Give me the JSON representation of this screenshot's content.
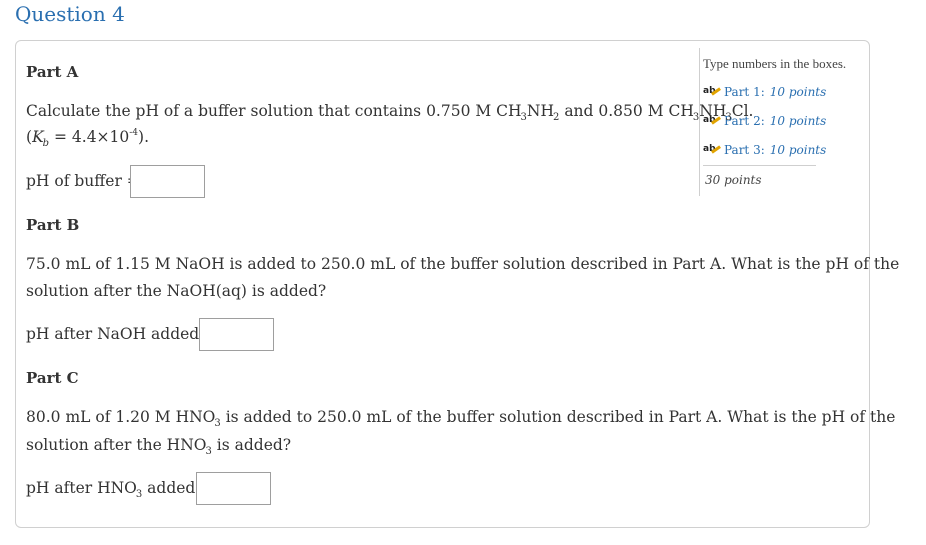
{
  "question": {
    "title": "Question 4"
  },
  "sidebar": {
    "instruction": "Type numbers in the boxes.",
    "parts": [
      {
        "label": "Part 1:",
        "points": "10 points"
      },
      {
        "label": "Part 2:",
        "points": "10 points"
      },
      {
        "label": "Part 3:",
        "points": "10 points"
      }
    ],
    "total": "30 points"
  },
  "part_a": {
    "heading": "Part A",
    "text_1": "Calculate the pH of a buffer solution that contains 0.750 M CH",
    "sub_1": "3",
    "text_2": "NH",
    "sub_2": "2",
    "text_3": " and 0.850 M CH",
    "sub_3": "3",
    "text_4": "NH",
    "sub_4": "3",
    "text_5": "Cl.",
    "kb_open": "(",
    "kb_k": "K",
    "kb_sub": "b",
    "kb_eq": " = 4.4×10",
    "kb_exp": "-4",
    "kb_close": ").",
    "answer_label": "pH of buffer =",
    "answer_value": ""
  },
  "part_b": {
    "heading": "Part B",
    "line_1": "75.0 mL of 1.15 M NaOH is added to 250.0 mL of the buffer solution described in Part A. What is the pH of the",
    "line_2": "solution after the NaOH(aq) is added?",
    "answer_label": "pH after NaOH added =",
    "answer_value": ""
  },
  "part_c": {
    "heading": "Part C",
    "line_1a": "80.0 mL of 1.20 M HNO",
    "line_1_sub": "3",
    "line_1b": " is added to 250.0 mL of the buffer solution described in Part A. What is the pH of the",
    "line_2a": "solution after the HNO",
    "line_2_sub": "3",
    "line_2b": " is added?",
    "answer_label_a": "pH after HNO",
    "answer_label_sub": "3",
    "answer_label_b": " added =",
    "answer_value": ""
  }
}
